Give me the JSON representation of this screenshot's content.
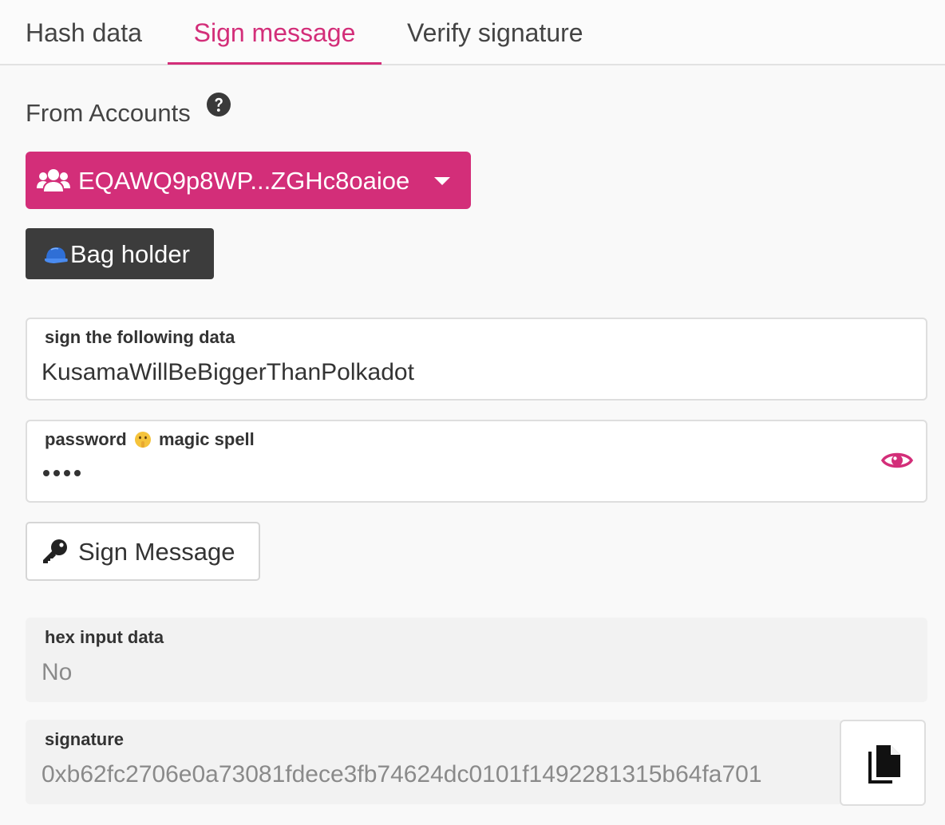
{
  "tabs": [
    {
      "label": "Hash data",
      "active": false
    },
    {
      "label": "Sign message",
      "active": true
    },
    {
      "label": "Verify signature",
      "active": false
    }
  ],
  "accent_color": "#d32e79",
  "from_accounts": {
    "label": "From Accounts",
    "help_icon": "question-circle-icon",
    "selected_account": "EQAWQ9p8WP...ZGHc8oaioe",
    "account_icon": "users-icon",
    "tag_label": "Bag holder",
    "tag_emoji_icon": "cap-icon"
  },
  "data_field": {
    "label": "sign the following data",
    "value": "KusamaWillBeBiggerThanPolkadot"
  },
  "password_field": {
    "label_part1": "password",
    "label_emoji_icon": "shushing-face-icon",
    "label_part2": "magic spell",
    "masked_length": 4,
    "toggle_icon": "eye-icon"
  },
  "sign_button": {
    "label": "Sign Message",
    "icon": "key-icon"
  },
  "hex_field": {
    "label": "hex input data",
    "value": "No"
  },
  "signature_field": {
    "label": "signature",
    "value": "0xb62fc2706e0a73081fdece3fb74624dc0101f1492281315b64fa701",
    "copy_icon": "copy-icon"
  }
}
